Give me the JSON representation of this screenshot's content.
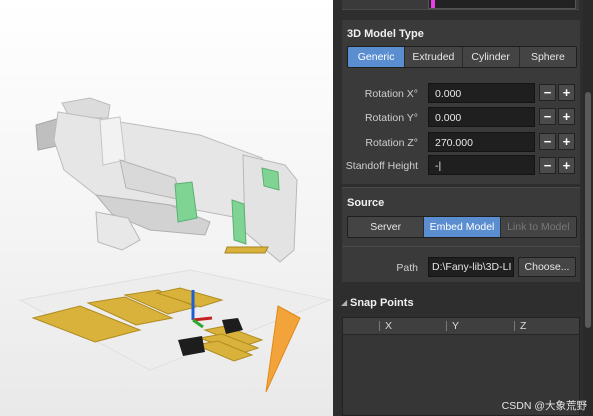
{
  "model_type": {
    "title": "3D Model Type",
    "options": [
      "Generic",
      "Extruded",
      "Cylinder",
      "Sphere"
    ],
    "selected": "Generic"
  },
  "rotation": {
    "x_label": "Rotation X°",
    "x_value": "0.000",
    "y_label": "Rotation Y°",
    "y_value": "0.000",
    "z_label": "Rotation Z°",
    "z_value": "270.000",
    "minus": "−",
    "plus": "+"
  },
  "standoff": {
    "label": "Standoff Height",
    "value": "-|"
  },
  "source": {
    "title": "Source",
    "options": [
      "Server",
      "Embed Model",
      "Link to Model"
    ],
    "selected": "Embed Model"
  },
  "path": {
    "label": "Path",
    "value": "D:\\Fany-lib\\3D-LI",
    "choose_label": "Choose..."
  },
  "snap_points": {
    "title": "Snap Points",
    "collapse_glyph": "◢",
    "columns": [
      "X",
      "Y",
      "Z"
    ]
  },
  "watermark": "CSDN @大象荒野",
  "colors": {
    "accent": "#5b8ed0",
    "panel_bg": "#3a3a3a",
    "model_body": "#e2e2e2",
    "model_green": "#7fd494",
    "pad_gold": "#d8b23a"
  }
}
